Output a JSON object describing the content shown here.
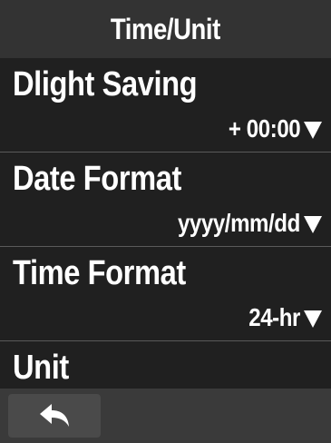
{
  "header": {
    "title": "Time/Unit"
  },
  "settings": [
    {
      "label": "Dlight Saving",
      "value": "+ 00:00"
    },
    {
      "label": "Date Format",
      "value": "yyyy/mm/dd"
    },
    {
      "label": "Time Format",
      "value": "24-hr"
    },
    {
      "label": "Unit"
    }
  ],
  "icons": {
    "back": "back-arrow-icon",
    "dropdown": "caret-down-icon"
  },
  "colors": {
    "background": "#202020",
    "title_bar": "#333333",
    "bottom_bar": "#3a3a3a",
    "text": "#ffffff"
  }
}
